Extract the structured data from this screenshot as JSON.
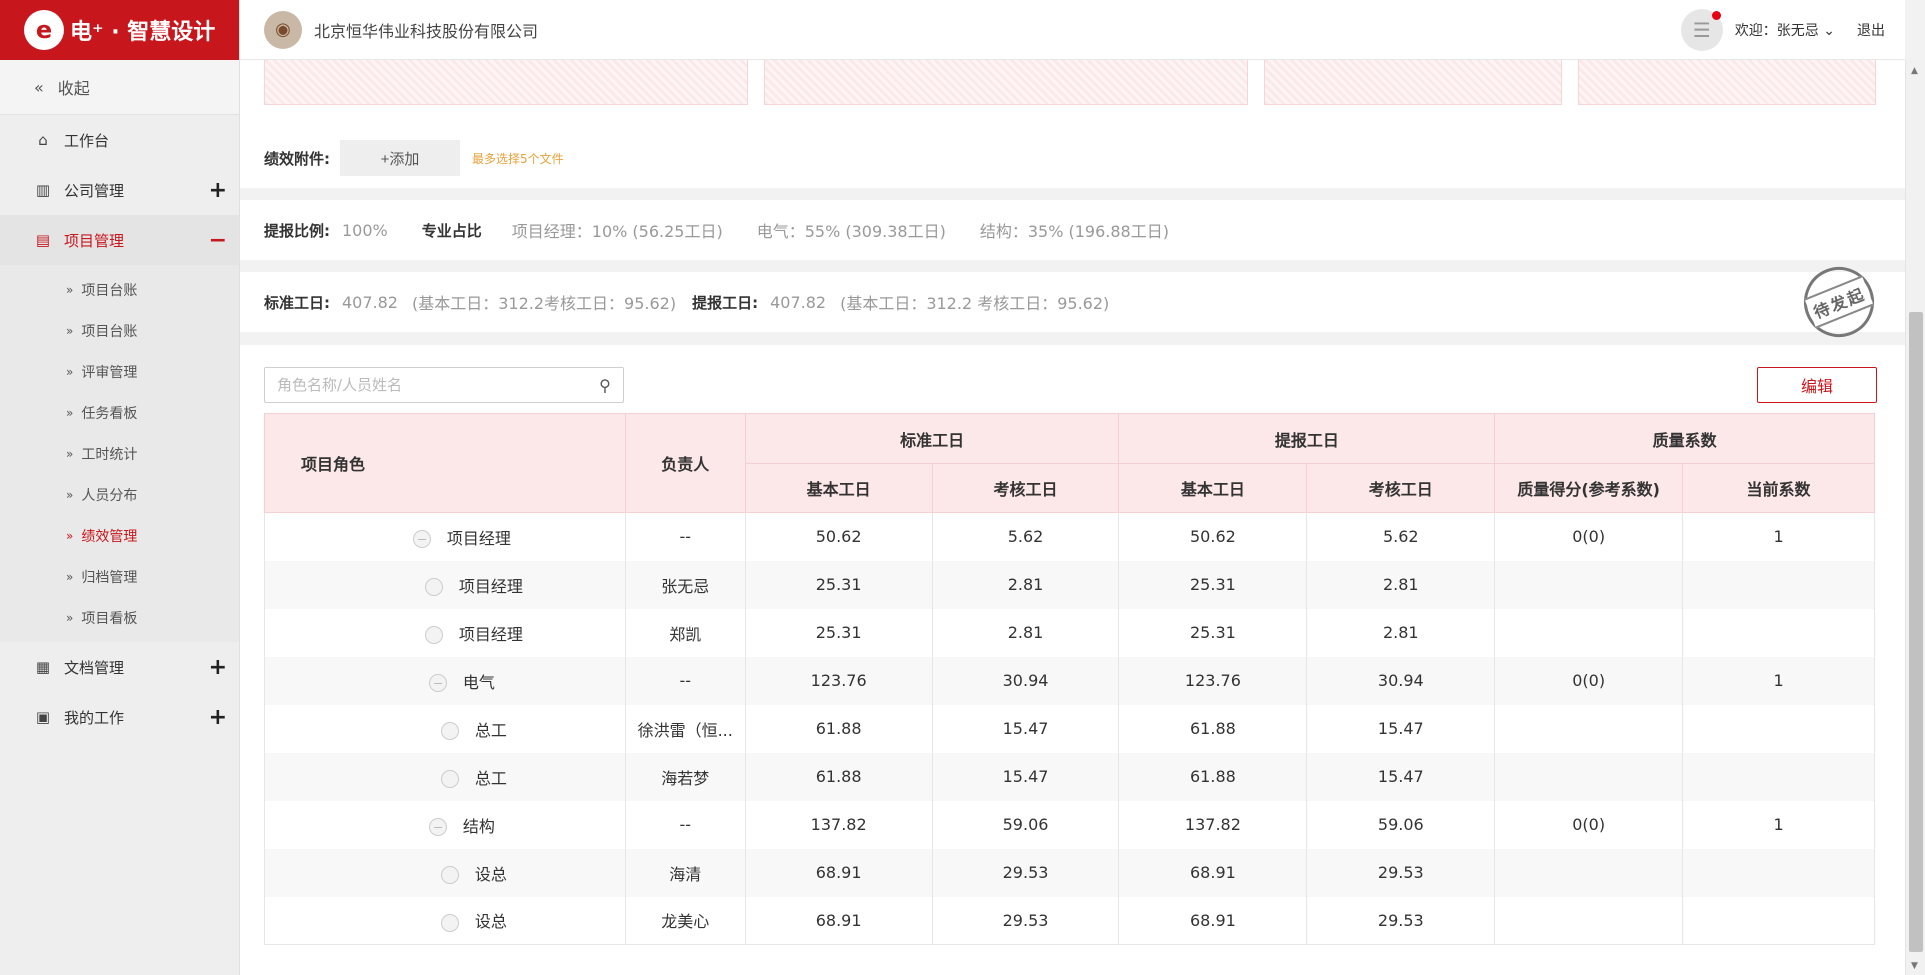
{
  "app": {
    "logo_text": "电⁺ · 智慧设计",
    "company": "北京恒华伟业科技股份有限公司",
    "welcome": "欢迎：张无忌",
    "logout": "退出"
  },
  "sidebar": {
    "collapse": "收起",
    "items": [
      {
        "label": "工作台",
        "icon": "home-icon"
      },
      {
        "label": "公司管理",
        "icon": "building-icon",
        "toggle": "+"
      },
      {
        "label": "项目管理",
        "icon": "project-icon",
        "toggle": "−"
      },
      {
        "label": "文档管理",
        "icon": "document-icon",
        "toggle": "+"
      },
      {
        "label": "我的工作",
        "icon": "work-icon",
        "toggle": "+"
      }
    ],
    "sub_items": [
      "项目台账",
      "项目台账",
      "评审管理",
      "任务看板",
      "工时统计",
      "人员分布",
      "绩效管理",
      "归档管理",
      "项目看板"
    ]
  },
  "attachments": {
    "label": "绩效附件:",
    "add": "+添加",
    "hint": "最多选择5个文件"
  },
  "ratio": {
    "label": "提报比例:",
    "value": "100%",
    "share_label": "专业占比",
    "pm": "项目经理：10% (56.25工日)",
    "electric": "电气：55% (309.38工日)",
    "structure": "结构：35% (196.88工日)"
  },
  "workdays": {
    "std_label": "标准工日:",
    "std_value": "407.82",
    "std_detail": "(基本工日：312.2考核工日：95.62)",
    "rep_label": "提报工日:",
    "rep_value": "407.82",
    "rep_detail": "(基本工日：312.2 考核工日：95.62)",
    "status": "待发起"
  },
  "search": {
    "placeholder": "角色名称/人员姓名"
  },
  "edit_label": "编辑",
  "table": {
    "headers": {
      "role": "项目角色",
      "owner": "负责人",
      "std": "标准工日",
      "rep": "提报工日",
      "quality": "质量系数",
      "basic": "基本工日",
      "assess": "考核工日",
      "score": "质量得分(参考系数)",
      "coef": "当前系数"
    },
    "rows": [
      {
        "level": 1,
        "role": "项目经理",
        "owner": "--",
        "std_basic": "50.62",
        "std_assess": "5.62",
        "rep_basic": "50.62",
        "rep_assess": "5.62",
        "score": "0(0)",
        "coef": "1"
      },
      {
        "level": 2,
        "role": "项目经理",
        "owner": "张无忌",
        "std_basic": "25.31",
        "std_assess": "2.81",
        "rep_basic": "25.31",
        "rep_assess": "2.81",
        "score": "",
        "coef": ""
      },
      {
        "level": 2,
        "role": "项目经理",
        "owner": "郑凯",
        "std_basic": "25.31",
        "std_assess": "2.81",
        "rep_basic": "25.31",
        "rep_assess": "2.81",
        "score": "",
        "coef": ""
      },
      {
        "level": 1,
        "role": "电气",
        "owner": "--",
        "std_basic": "123.76",
        "std_assess": "30.94",
        "rep_basic": "123.76",
        "rep_assess": "30.94",
        "score": "0(0)",
        "coef": "1"
      },
      {
        "level": 2,
        "role": "总工",
        "owner": "徐洪雷（恒...",
        "std_basic": "61.88",
        "std_assess": "15.47",
        "rep_basic": "61.88",
        "rep_assess": "15.47",
        "score": "",
        "coef": ""
      },
      {
        "level": 2,
        "role": "总工",
        "owner": "海若梦",
        "std_basic": "61.88",
        "std_assess": "15.47",
        "rep_basic": "61.88",
        "rep_assess": "15.47",
        "score": "",
        "coef": ""
      },
      {
        "level": 1,
        "role": "结构",
        "owner": "--",
        "std_basic": "137.82",
        "std_assess": "59.06",
        "rep_basic": "137.82",
        "rep_assess": "59.06",
        "score": "0(0)",
        "coef": "1"
      },
      {
        "level": 2,
        "role": "设总",
        "owner": "海清",
        "std_basic": "68.91",
        "std_assess": "29.53",
        "rep_basic": "68.91",
        "rep_assess": "29.53",
        "score": "",
        "coef": ""
      },
      {
        "level": 2,
        "role": "设总",
        "owner": "龙美心",
        "std_basic": "68.91",
        "std_assess": "29.53",
        "rep_basic": "68.91",
        "rep_assess": "29.53",
        "score": "",
        "coef": ""
      }
    ]
  },
  "colors": {
    "brand": "#c8161d",
    "header_bg": "#fde8e9",
    "hint": "#e6a23c"
  }
}
